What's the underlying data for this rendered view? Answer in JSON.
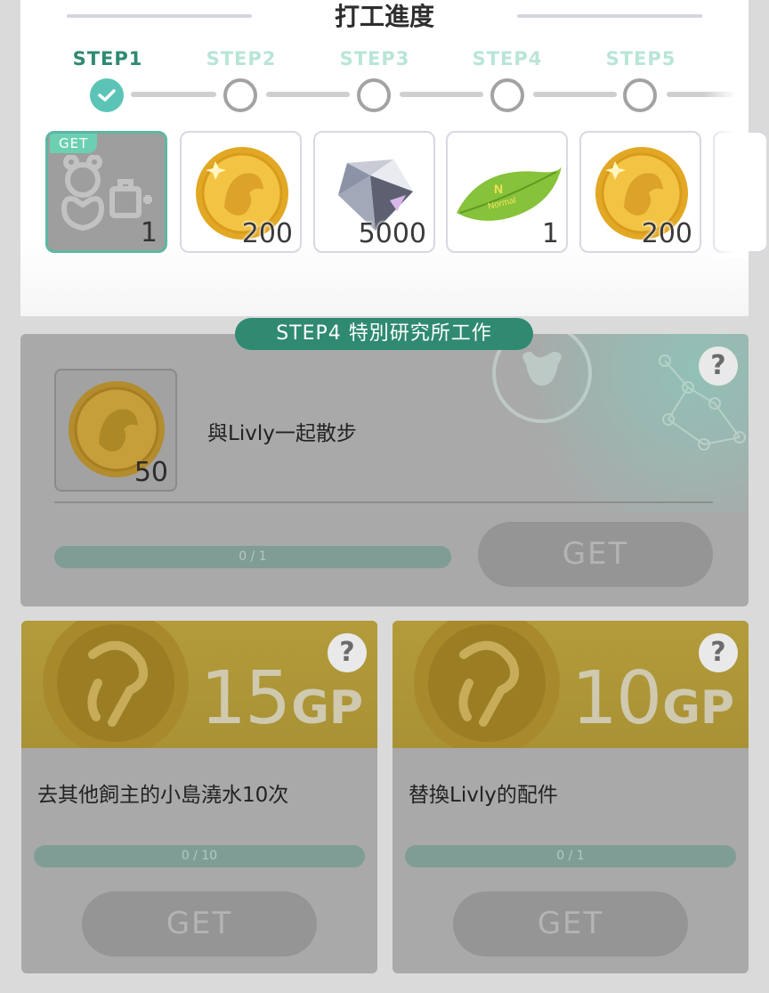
{
  "panel": {
    "title": "打工進度",
    "steps": [
      {
        "label": "STEP1",
        "done": true
      },
      {
        "label": "STEP2",
        "done": false
      },
      {
        "label": "STEP3",
        "done": false
      },
      {
        "label": "STEP4",
        "done": false
      },
      {
        "label": "STEP5",
        "done": false
      }
    ],
    "rewards": [
      {
        "icon": "livly-closet-icon",
        "count": "1",
        "badge": "GET",
        "claimed": true
      },
      {
        "icon": "gold-coin-icon",
        "count": "200",
        "claimed": false
      },
      {
        "icon": "crystal-icon",
        "count": "5000",
        "claimed": false
      },
      {
        "icon": "leaf-ticket-icon",
        "count": "1",
        "claimed": false,
        "leaf_text": "Normal"
      },
      {
        "icon": "gold-coin-icon",
        "count": "200",
        "claimed": false
      }
    ]
  },
  "special_job": {
    "ribbon": "STEP4 特別研究所工作",
    "reward_count": "50",
    "title": "與Livly一起散步",
    "progress": "0 / 1",
    "progress_fraction": 0,
    "get_label": "GET",
    "help": "?"
  },
  "gp_jobs": [
    {
      "amount": "15",
      "unit": "GP",
      "title": "去其他飼主的小島澆水10次",
      "progress": "0 / 10",
      "progress_fraction": 0,
      "get_label": "GET",
      "help": "?"
    },
    {
      "amount": "10",
      "unit": "GP",
      "title": "替換Livly的配件",
      "progress": "0 / 1",
      "progress_fraction": 0,
      "get_label": "GET",
      "help": "?"
    }
  ],
  "colors": {
    "accent_green": "#2f8a71",
    "step_done": "#5cc4b6",
    "step_pending_text": "#b9e5d8",
    "gp_banner": "#b39b3a"
  }
}
